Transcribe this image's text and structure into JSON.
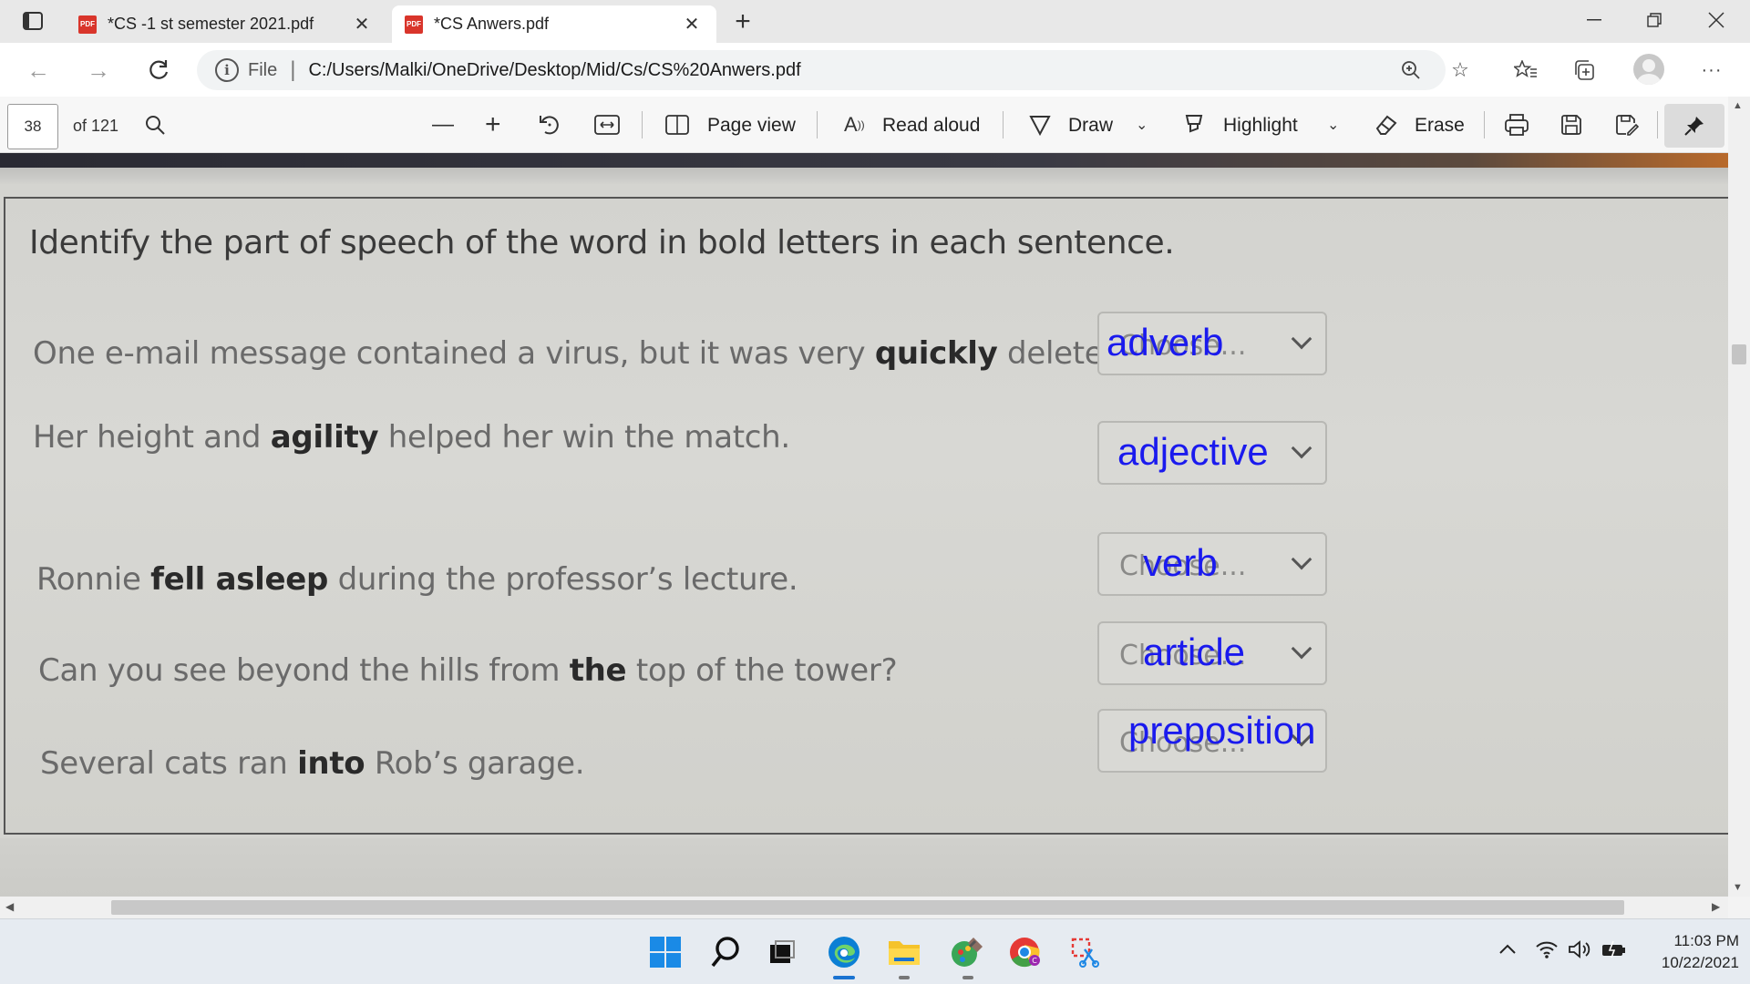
{
  "tabs": [
    {
      "label": "*CS -1 st semester 2021.pdf",
      "active": false
    },
    {
      "label": "*CS Anwers.pdf",
      "active": true
    }
  ],
  "address": {
    "scheme": "File",
    "url": "C:/Users/Malki/OneDrive/Desktop/Mid/Cs/CS%20Anwers.pdf"
  },
  "pdf_toolbar": {
    "page_number": "38",
    "page_count": "of 121",
    "page_view": "Page view",
    "read_aloud": "Read aloud",
    "draw": "Draw",
    "highlight": "Highlight",
    "erase": "Erase"
  },
  "quiz": {
    "title": "Identify the part of speech of the word in bold letters in each sentence.",
    "items": [
      {
        "before": "One e-mail message contained a virus, but it was very ",
        "bold": "quickly",
        "after": " deleted.",
        "placeholder": "Choose...",
        "answer": "adverb"
      },
      {
        "before": "Her height and ",
        "bold": "agility",
        "after": " helped her win the match.",
        "placeholder": "",
        "answer": "adjective"
      },
      {
        "before": "Ronnie ",
        "bold": "fell asleep",
        "after": " during the professor’s lecture.",
        "placeholder": "Choose...",
        "answer": "verb"
      },
      {
        "before": "Can you see beyond the hills from ",
        "bold": "the",
        "after": " top of the tower?",
        "placeholder": "Choose...",
        "answer": "article"
      },
      {
        "before": "Several cats ran ",
        "bold": "into",
        "after": " Rob’s garage.",
        "placeholder": "Choose...",
        "answer": "preposition"
      }
    ]
  },
  "answer_color": "#1a1aee",
  "clock": {
    "time": "11:03 PM",
    "date": "10/22/2021"
  }
}
